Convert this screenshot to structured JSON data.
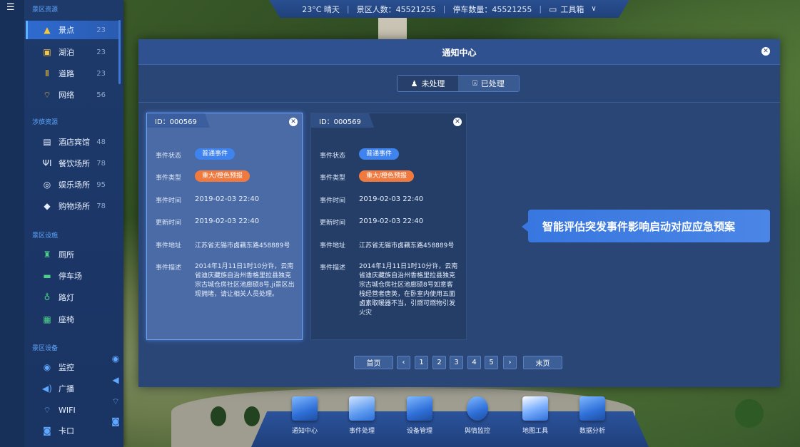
{
  "topbar": {
    "weather": "23°C 晴天",
    "visitors": "景区人数：45521255",
    "parking": "停车数量：45521255",
    "toolbox": "工具箱"
  },
  "sidebar": {
    "sections": [
      {
        "title": "景区资源"
      },
      {
        "title": "涉旅资源"
      },
      {
        "title": "景区设施"
      },
      {
        "title": "景区设备"
      }
    ],
    "items": [
      {
        "label": "景点",
        "count": "23",
        "icon": "mountain-icon"
      },
      {
        "label": "湖泊",
        "count": "23",
        "icon": "lake-icon"
      },
      {
        "label": "道路",
        "count": "23",
        "icon": "road-icon"
      },
      {
        "label": "网络",
        "count": "56",
        "icon": "wifi-icon"
      },
      {
        "label": "酒店宾馆",
        "count": "48",
        "icon": "hotel-icon"
      },
      {
        "label": "餐饮场所",
        "count": "78",
        "icon": "dining-icon"
      },
      {
        "label": "娱乐场所",
        "count": "95",
        "icon": "entertainment-icon"
      },
      {
        "label": "购物场所",
        "count": "78",
        "icon": "shopping-icon"
      },
      {
        "label": "厕所",
        "icon": "toilet-icon"
      },
      {
        "label": "停车场",
        "icon": "parking-icon"
      },
      {
        "label": "路灯",
        "icon": "streetlight-icon"
      },
      {
        "label": "座椅",
        "icon": "bench-icon"
      },
      {
        "label": "监控",
        "icon": "camera-icon"
      },
      {
        "label": "广播",
        "icon": "speaker-icon"
      },
      {
        "label": "WIFI",
        "icon": "wifi-icon"
      },
      {
        "label": "卡口",
        "icon": "checkpoint-icon"
      }
    ]
  },
  "modal": {
    "title": "通知中心",
    "tabs": [
      {
        "label": "未处理"
      },
      {
        "label": "已处理"
      }
    ],
    "cards": [
      {
        "id": "ID：000569",
        "status_label": "事件状态",
        "status": "普通事件",
        "type_label": "事件类型",
        "type": "重大/橙色预报",
        "time_label": "事件时间",
        "time": "2019-02-03 22:40",
        "update_label": "更新时间",
        "update": "2019-02-03 22:40",
        "addr_label": "事件地址",
        "addr": "江苏省无锡市卤藕东路458889号",
        "desc_label": "事件描述",
        "desc": "2014年1月11日1时10分许，云南省迪庆藏族自治州香格里拉县独克宗古城仓房社区池廊硕8号,ji景区出现拥堵，请让相关人员处理。"
      },
      {
        "id": "ID：000569",
        "status_label": "事件状态",
        "status": "普通事件",
        "type_label": "事件类型",
        "type": "重大/橙色预报",
        "time_label": "事件时间",
        "time": "2019-02-03 22:40",
        "update_label": "更新时间",
        "update": "2019-02-03 22:40",
        "addr_label": "事件地址",
        "addr": "江苏省无锡市卤藕东路458889号",
        "desc_label": "事件描述",
        "desc": "2014年1月11日1时10分许，云南省迪庆藏族自治州香格里拉县独克宗古城仓房社区池廊硕8号如意客栈经营者唐英，在卧室内使用五面卤素取暖器不当，引燃可燃物引发火灾"
      }
    ],
    "callout": "智能评估突发事件影响启动对应应急预案",
    "pager": {
      "first": "首页",
      "prev": "‹",
      "pages": [
        "1",
        "2",
        "3",
        "4",
        "5"
      ],
      "next": "›",
      "last": "末页"
    }
  },
  "dock": [
    {
      "label": "通知中心",
      "icon": "notification-center-icon"
    },
    {
      "label": "事件处理",
      "icon": "event-handling-icon"
    },
    {
      "label": "设备管理",
      "icon": "device-management-icon"
    },
    {
      "label": "舆情监控",
      "icon": "opinion-monitor-icon"
    },
    {
      "label": "地图工具",
      "icon": "map-tools-icon"
    },
    {
      "label": "数据分析",
      "icon": "data-analysis-icon"
    }
  ]
}
